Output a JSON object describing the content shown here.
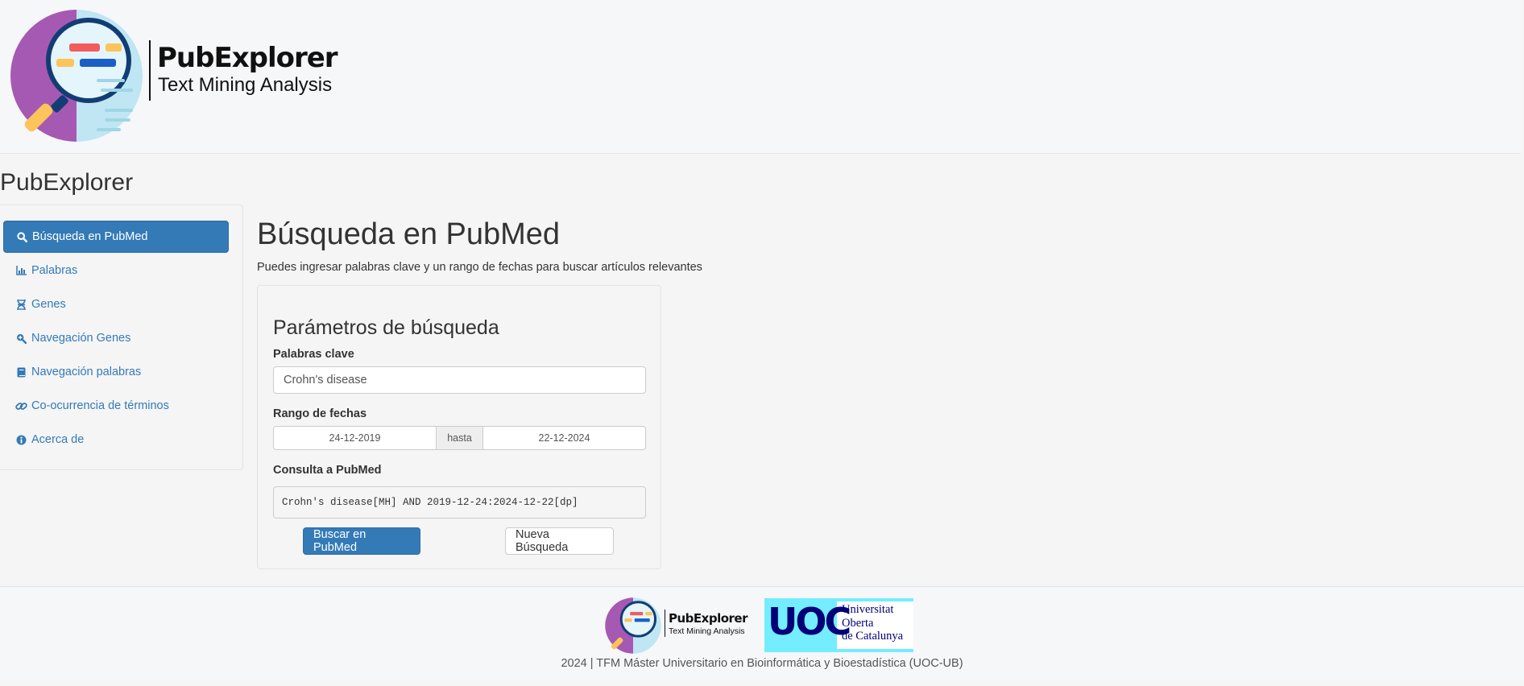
{
  "header": {
    "logo_name": "PubExplorer",
    "logo_tagline": "Text Mining Analysis"
  },
  "app": {
    "title": "PubExplorer"
  },
  "sidebar": {
    "items": [
      {
        "label": "Búsqueda en PubMed",
        "icon": "search-icon",
        "active": true
      },
      {
        "label": "Palabras",
        "icon": "bar-chart-icon"
      },
      {
        "label": "Genes",
        "icon": "dna-icon"
      },
      {
        "label": "Navegación Genes",
        "icon": "search-plus-icon"
      },
      {
        "label": "Navegación palabras",
        "icon": "book-icon"
      },
      {
        "label": "Co-ocurrencia de términos",
        "icon": "link-icon"
      },
      {
        "label": "Acerca de",
        "icon": "info-icon"
      }
    ]
  },
  "main": {
    "title": "Búsqueda en PubMed",
    "description": "Puedes ingresar palabras clave y un rango de fechas para buscar artículos relevantes",
    "panel": {
      "title": "Parámetros de búsqueda",
      "keywords_label": "Palabras clave",
      "keywords_value": "Crohn's disease",
      "date_label": "Rango de fechas",
      "date_start": "24-12-2019",
      "date_sep": "hasta",
      "date_end": "22-12-2024",
      "query_label": "Consulta a PubMed",
      "query_value": "Crohn's disease[MH] AND 2019-12-24:2024-12-22[dp]",
      "search_button": "Buscar en PubMed",
      "new_search_button": "Nueva Búsqueda"
    }
  },
  "footer": {
    "logo_name": "PubExplorer",
    "logo_tagline": "Text Mining Analysis",
    "uoc_letters": "UOC",
    "uoc_line1": "Universitat",
    "uoc_line2": "Oberta",
    "uoc_line3": "de Catalunya",
    "credit": "2024 | TFM Máster Universitario en Bioinformática y Bioestadística (UOC-UB)"
  },
  "colors": {
    "primary": "#337ab7",
    "uoc_cyan": "#73edff",
    "uoc_navy": "#000078"
  }
}
